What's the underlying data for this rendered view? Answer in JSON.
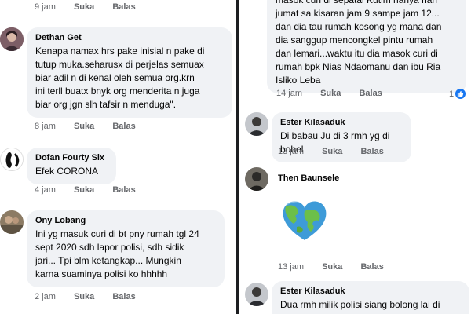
{
  "left_column": {
    "top_actions": {
      "time": "9 jam",
      "like": "Suka",
      "reply": "Balas"
    },
    "comments": [
      {
        "author": "Dethan Get",
        "text": "Kenapa namax hrs pake inisial n pake di\ntutup muka.seharusx di perjelas semuax\nbiar adil n di kenal oleh semua org.krn\nini terll buatx bnyk org menderita n juga\nbiar org jgn slh tafsir n menduga\".",
        "time": "8 jam",
        "like": "Suka",
        "reply": "Balas"
      },
      {
        "author": "Dofan Fourty Six",
        "text": "Efek CORONA",
        "time": "4 jam",
        "like": "Suka",
        "reply": "Balas"
      },
      {
        "author": "Ony Lobang",
        "text": "Ini yg masuk curi di bt pny rumah tgl 24\nsept 2020 sdh lapor polisi, sdh sidik\njari... Tpi blm ketangkap... Mungkin\nkarna suaminya polisi ko hhhhh",
        "time": "2 jam",
        "like": "Suka",
        "reply": "Balas"
      }
    ]
  },
  "right_column": {
    "top_comment": {
      "partial_first_line": "masok curi di sepatal Kutim hanya hari",
      "text": "jumat sa kisaran jam 9 sampe jam 12...\ndan dia tau rumah kosong yg mana dan\ndia sanggup mencongkel pintu rumah\ndan lemari...waktu itu dia masok curi di\nrumah bpk Nias Ndaomanu dan ibu Ria\nIsliko Leba",
      "time": "14 jam",
      "like": "Suka",
      "reply": "Balas",
      "reaction_count": "1"
    },
    "comments": [
      {
        "author": "Ester Kilasaduk",
        "text": "Di babau Ju di 3 rmh yg di bobol",
        "time": "13 jam",
        "like": "Suka",
        "reply": "Balas"
      },
      {
        "author": "Then Baunsele",
        "sticker": "earth-heart-sticker",
        "time": "13 jam",
        "like": "Suka",
        "reply": "Balas"
      },
      {
        "author": "Ester Kilasaduk",
        "text": "Dua rmh milik polisi siang bolong lai di"
      }
    ]
  },
  "colors": {
    "bubble": "#f0f2f5",
    "meta": "#65676b",
    "text": "#050505",
    "divider": "#1c1e21",
    "like_blue": "#1877f2"
  }
}
